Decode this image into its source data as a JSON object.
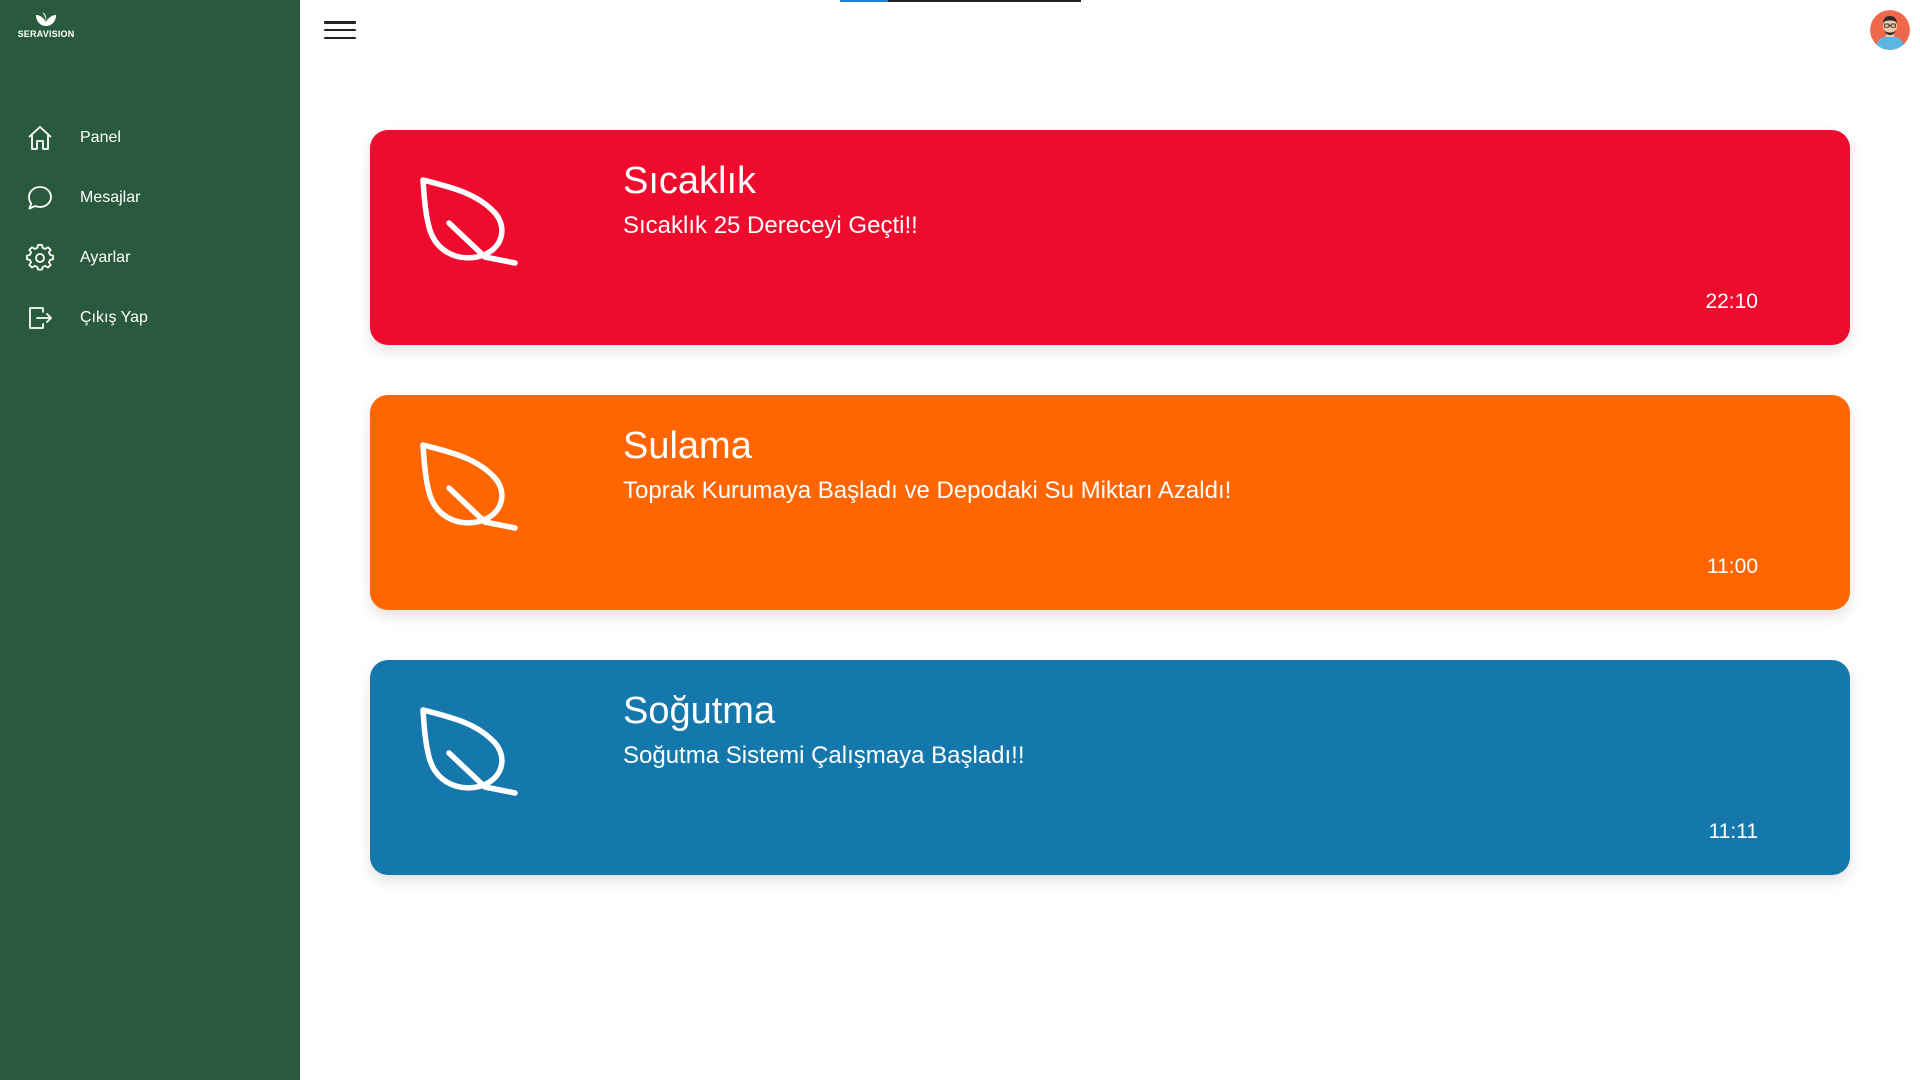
{
  "brand": {
    "name": "SERAVISION",
    "icon": "leaf-logo-icon"
  },
  "sidebar": {
    "items": [
      {
        "label": "Panel",
        "icon": "home-icon"
      },
      {
        "label": "Mesajlar",
        "icon": "chat-bubble-icon"
      },
      {
        "label": "Ayarlar",
        "icon": "gear-icon"
      },
      {
        "label": "Çıkış Yap",
        "icon": "logout-icon"
      }
    ],
    "background": "#2a5a3d"
  },
  "topbar": {
    "menu_icon": "hamburger-icon",
    "avatar_icon": "user-avatar-icon",
    "progress": 0.2
  },
  "notifications": [
    {
      "title": "Sıcaklık",
      "message": "Sıcaklık 25 Dereceyi Geçti!!",
      "time": "22:10",
      "color": "#ee0b2d",
      "icon": "leaf-icon"
    },
    {
      "title": "Sulama",
      "message": "Toprak Kurumaya Başladı ve Depodaki Su Miktarı Azaldı!",
      "time": "11:00",
      "color": "#ff6500",
      "icon": "leaf-icon"
    },
    {
      "title": "Soğutma",
      "message": "Soğutma Sistemi Çalışmaya Başladı!!",
      "time": "11:11",
      "color": "#1478ad",
      "icon": "leaf-icon"
    }
  ]
}
